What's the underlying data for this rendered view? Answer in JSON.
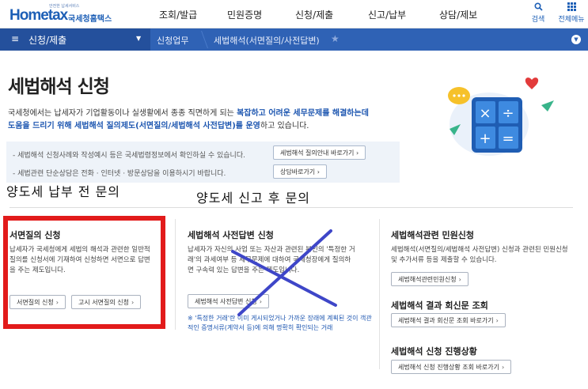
{
  "header": {
    "logo_small": "안전한 납세서비스",
    "logo_main": "Hometax",
    "logo_kr": "국세청홈택스",
    "menu": [
      "조회/발급",
      "민원증명",
      "신청/제출",
      "신고/납부",
      "상담/제보"
    ],
    "util": [
      {
        "icon": "search-icon",
        "label": "검색"
      },
      {
        "icon": "grid-icon",
        "label": "전체메뉴"
      }
    ]
  },
  "breadcrumb": {
    "menu_label": "신청/제출",
    "items": [
      "신청업무",
      "세법해석(서면질의/사전답변)"
    ]
  },
  "hero": {
    "title": "세법해석 신청",
    "intro_1": "국세청에서는 납세자가 기업활동이나 실생활에서 종종 직면하게 되는 ",
    "intro_hl_1": "복잡하고 어려운 세무문제를 해결하는데",
    "intro_hl_2": "도움을 드리기 위해 세법해석 질의제도(서면질의/세법해석 사전답변)를 운영",
    "intro_2": "하고 있습니다.",
    "info_1": "- 세법해석 신청사례와 작성예시 등은 국세법령정보에서 확인하실 수 있습니다.",
    "info_1_btn": "세법해석 질의안내 바로가기",
    "info_2": "- 세법관련 단순상담은 전화 · 인터넷 · 방문상담을 이용하시기 바랍니다.",
    "info_2_btn": "상담바로가기"
  },
  "annotations": {
    "note1": "양도세 납부 전 문의",
    "note2": "양도세 신고 후 문의"
  },
  "col1": {
    "title": "서면질의 신청",
    "desc": "납세자가 국세청에게 세법의 해석과 관련한 일반적 질의를 신청서에 기재하여 신청하면 서면으로 답변을 주는 제도입니다.",
    "btn1": "서면질의 신청",
    "btn2": "고시 서면질의 신청"
  },
  "col2": {
    "title": "세법해석 사전답변 신청",
    "desc": "납세자가 자신의 사업 또는 자산과 관련된 본인의 '특정한 거래'의 과세여부 등 세무문제에 대하여 국세청장에게 질의하면 구속력 있는 답변을 주는 제도입니다.",
    "btn1": "세법해석 사전답변 신청",
    "note": "※ '특정한 거래'란 이미 게시되었거나 가까운 장래에 계획된 것이 객관적인 증명서류(계약서 등)에 의해 명확히 확인되는 거래"
  },
  "col3": {
    "title1": "세법해석관련 민원신청",
    "desc1": "세법해석(서면질의/세법해석 사전답변) 신청과 관련된 민원신청 및 추가서류 등을 제출할 수 있습니다.",
    "btn1": "세법해석관련민원신청",
    "title2": "세법해석 결과 회신문 조회",
    "btn2": "세법해석 결과 회신문 조회 바로가기",
    "title3": "세법해석 신청 진행상황",
    "btn3": "세법해석 신청 진행상황 조회 바로가기"
  },
  "colors": {
    "brand_blue": "#2f62b5",
    "highlight": "#1d56b0",
    "annotation_red": "#e21b1b",
    "annotation_x": "#3e46c8"
  }
}
